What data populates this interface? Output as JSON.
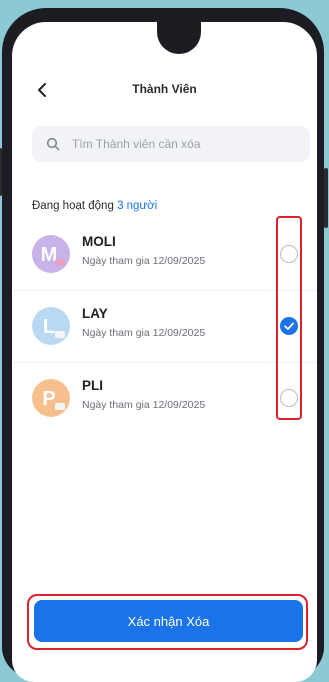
{
  "header": {
    "title": "Thành Viên",
    "back_icon": "chevron-left-icon"
  },
  "search": {
    "placeholder": "Tìm Thành viên cần xóa",
    "value": "",
    "icon": "search-icon"
  },
  "active": {
    "label": "Đang hoạt động",
    "count_text": "3 người"
  },
  "members": [
    {
      "name": "MOLI",
      "joined": "Ngày tham gia 12/09/2025",
      "avatar_letter": "M",
      "avatar_color": "#c7b3e8",
      "selected": false
    },
    {
      "name": "LAY",
      "joined": "Ngày tham gia 12/09/2025",
      "avatar_letter": "L",
      "avatar_color": "#b9d8f2",
      "selected": true
    },
    {
      "name": "PLI",
      "joined": "Ngày tham gia 12/09/2025",
      "avatar_letter": "P",
      "avatar_color": "#f6c08e",
      "selected": false
    }
  ],
  "footer": {
    "confirm_label": "Xác nhận Xóa"
  },
  "colors": {
    "accent": "#1a73e8",
    "highlight": "#d9232d",
    "background": "#8cc9d3"
  }
}
